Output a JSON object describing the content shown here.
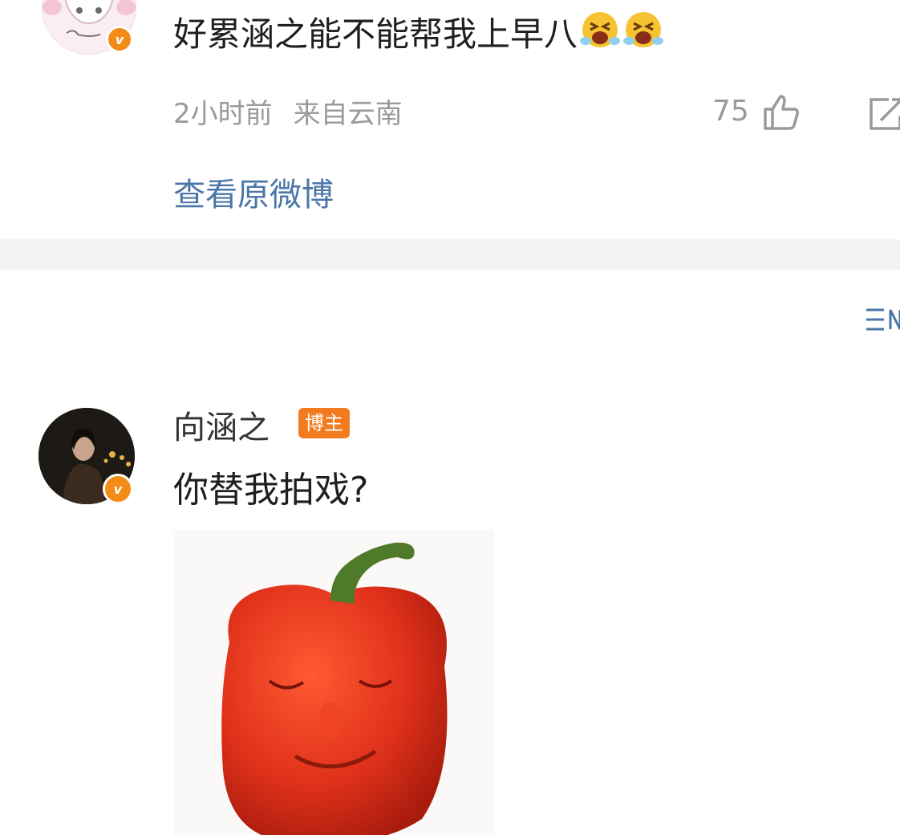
{
  "top_comment": {
    "text": "好累涵之能不能帮我上早八",
    "emojis": [
      "crying-emoji",
      "crying-emoji"
    ],
    "time": "2小时前",
    "location": "来自云南",
    "like_count": "75",
    "view_original_label": "查看原微博"
  },
  "reply": {
    "author": "向涵之",
    "author_badge": "博主",
    "text": "你替我拍戏?",
    "image": "red-bell-pepper-with-face"
  },
  "colors": {
    "link": "#4a76a8",
    "meta": "#9a9a9a",
    "badge": "#f27a1f",
    "verified": "#f28c16",
    "divider": "#f2f2f2"
  }
}
